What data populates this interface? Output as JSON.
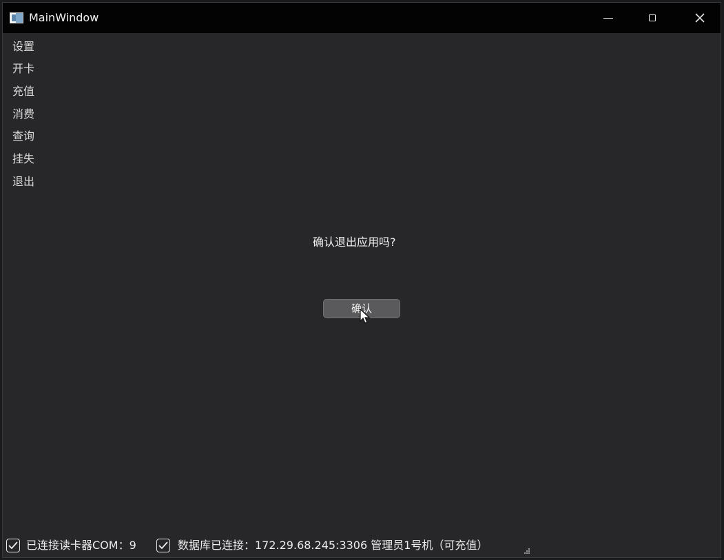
{
  "window": {
    "title": "MainWindow",
    "icons": {
      "app": "window-app-icon",
      "minimize": "minimize-icon",
      "maximize": "maximize-icon",
      "close": "close-icon"
    }
  },
  "sidebar": {
    "items": [
      {
        "label": "设置"
      },
      {
        "label": "开卡"
      },
      {
        "label": "充值"
      },
      {
        "label": "消费"
      },
      {
        "label": "查询"
      },
      {
        "label": "挂失"
      },
      {
        "label": "退出"
      }
    ]
  },
  "dialog": {
    "message": "确认退出应用吗?",
    "confirm_label": "确认"
  },
  "status": {
    "reader_checked": true,
    "reader_text": "已连接读卡器COM：9",
    "db_checked": true,
    "db_text": "数据库已连接：172.29.68.245:3306 管理员1号机（可充值）"
  },
  "colors": {
    "titlebar": "#030303",
    "window_bg": "#272729",
    "button_bg": "#5a5a5c",
    "text": "#f0f0f0"
  }
}
